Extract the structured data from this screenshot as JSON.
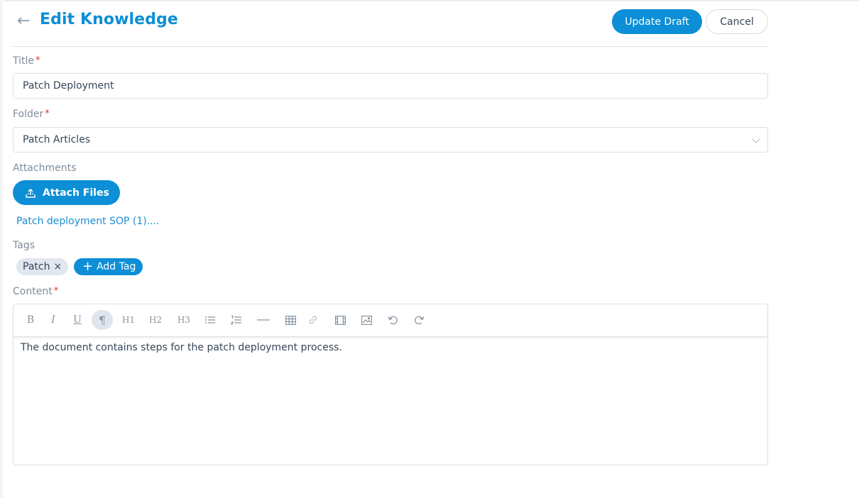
{
  "header": {
    "back_icon": "arrow-left-icon",
    "title": "Edit Knowledge",
    "update_draft_label": "Update Draft",
    "cancel_label": "Cancel"
  },
  "form": {
    "title_label": "Title",
    "title_value": "Patch Deployment",
    "folder_label": "Folder",
    "folder_value": "Patch Articles",
    "attachments_label": "Attachments",
    "attach_files_label": "Attach Files",
    "attachment_name": "Patch deployment SOP (1)....",
    "tags_label": "Tags",
    "tags": [
      "Patch"
    ],
    "tag_remove_glyph": "×",
    "add_tag_label": "Add Tag",
    "content_label": "Content",
    "required_marker": "*"
  },
  "editor": {
    "toolbar": [
      "bold-icon",
      "italic-icon",
      "underline-icon",
      "paragraph-icon",
      "h1-icon",
      "h2-icon",
      "h3-icon",
      "bullet-list-icon",
      "ordered-list-icon",
      "horizontal-rule-icon",
      "table-icon",
      "link-icon",
      "video-icon",
      "image-icon",
      "undo-icon",
      "redo-icon"
    ],
    "glyphs": {
      "bold": "B",
      "italic": "I",
      "underline": "U",
      "paragraph": "¶",
      "h1": "H1",
      "h2": "H2",
      "h3": "H3"
    },
    "content": "The document contains steps for the patch deployment process."
  },
  "colors": {
    "accent": "#0c8fd6",
    "required": "#e0352b",
    "text": "#364658",
    "muted": "#7f8c9a"
  }
}
